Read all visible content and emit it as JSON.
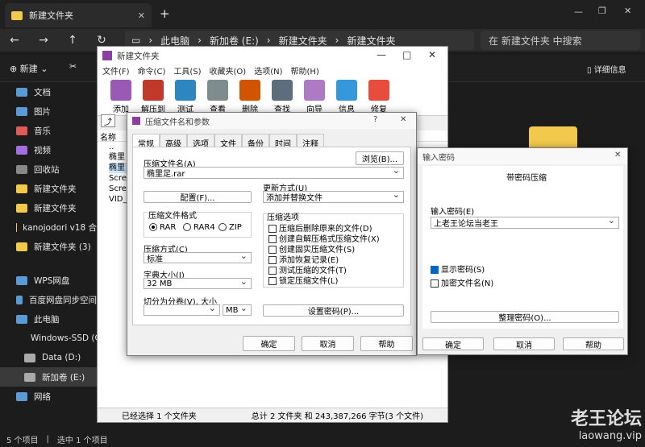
{
  "explorer": {
    "tab_title": "新建文件夹",
    "new_tab_symbol": "+",
    "breadcrumb": [
      "此电脑",
      "新加卷 (E:)",
      "新建文件夹",
      "新建文件夹"
    ],
    "search_placeholder": "在 新建文件夹 中搜索",
    "new_label": "新建",
    "details_label": "详细信息",
    "sidebar": [
      "文档",
      "图片",
      "音乐",
      "视频",
      "回收站",
      "新建文件夹",
      "新建文件夹",
      "kanojodori v18 合",
      "新建文件夹 (3)",
      "WPS网盘",
      "百度网盘同步空间",
      "此电脑",
      "Windows-SSD (C",
      "Data (D:)",
      "新加卷 (E:)",
      "网络"
    ],
    "status": [
      "5 个项目",
      "选中 1 个项目"
    ]
  },
  "rar": {
    "title": "新建文件夹",
    "menu": [
      "文件(F)",
      "命令(C)",
      "工具(S)",
      "收藏夹(O)",
      "选项(N)",
      "帮助(H)"
    ],
    "tools": [
      "添加",
      "解压到",
      "测试",
      "查看",
      "删除",
      "查找",
      "向导",
      "信息",
      "修复"
    ],
    "list_header": "名称",
    "files": [
      "..",
      "椭里",
      "椭里",
      "Scre",
      "Scre",
      "VID_"
    ],
    "status_left": "已经选择 1 个文件夹",
    "status_right": "总计 2 文件夹 和 243,387,266 字节(3 个文件)"
  },
  "archive_dialog": {
    "title": "压缩文件名和参数",
    "help_q": "?",
    "tabs": [
      "常规",
      "高级",
      "选项",
      "文件",
      "备份",
      "时间",
      "注释"
    ],
    "archive_name_label": "压缩文件名(A)",
    "archive_name": "椭里足.rar",
    "browse": "浏览(B)...",
    "profile": "配置(F)...",
    "update_mode_label": "更新方式(U)",
    "update_mode": "添加并替换文件",
    "format_label": "压缩文件格式",
    "formats": [
      "RAR",
      "RAR4",
      "ZIP"
    ],
    "method_label": "压缩方式(C)",
    "method": "标准",
    "dict_label": "字典大小(I)",
    "dict": "32 MB",
    "split_label": "切分为分卷(V), 大小",
    "split_unit": "MB",
    "options_label": "压缩选项",
    "options": [
      "压缩后删除原来的文件(D)",
      "创建自解压格式压缩文件(X)",
      "创建固实压缩文件(S)",
      "添加恢复记录(E)",
      "测试压缩的文件(T)",
      "锁定压缩文件(L)"
    ],
    "set_password": "设置密码(P)...",
    "ok": "确定",
    "cancel": "取消",
    "help": "帮助"
  },
  "password_dialog": {
    "title": "输入密码",
    "heading": "带密码压缩",
    "pwd_label": "输入密码(E)",
    "pwd_value": "上老王论坛当老王",
    "show_pwd": "显示密码(S)",
    "encrypt_names": "加密文件名(N)",
    "organize": "整理密码(O)...",
    "ok": "确定",
    "cancel": "取消",
    "help": "帮助"
  },
  "watermark": {
    "name": "老王论坛",
    "url": "laowang.vip"
  }
}
